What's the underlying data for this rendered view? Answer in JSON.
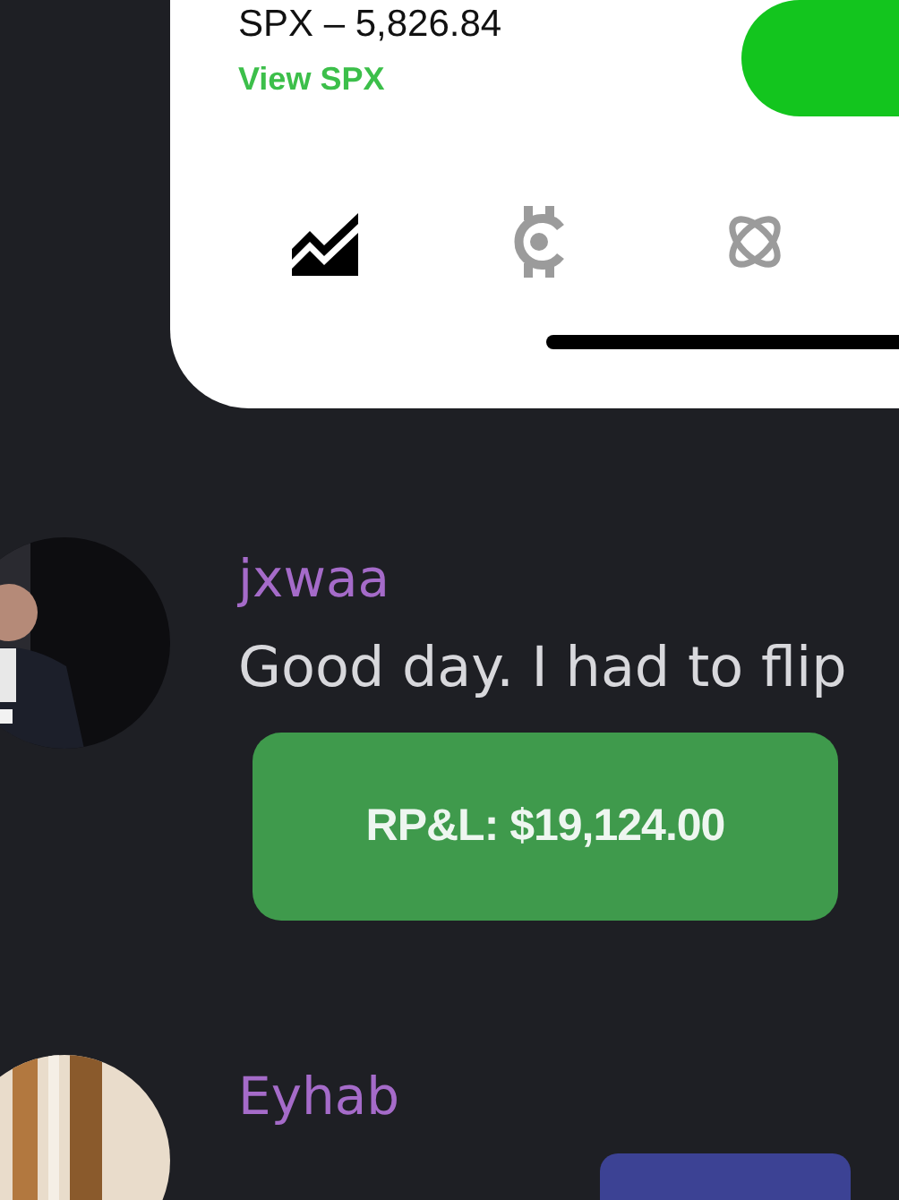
{
  "ticker_card": {
    "quote": "SPX – 5,826.84",
    "link": "View SPX",
    "tabs": [
      {
        "kind": "chart",
        "selected": true
      },
      {
        "kind": "coin",
        "selected": false
      },
      {
        "kind": "orbit",
        "selected": false
      }
    ]
  },
  "messages": [
    {
      "author": "jxwaa",
      "text": "Good day. I had to flip",
      "attachment": {
        "kind": "pnl",
        "text": "RP&L: $19,124.00"
      }
    },
    {
      "author": "Eyhab",
      "attachment": {
        "kind": "embed"
      }
    }
  ]
}
